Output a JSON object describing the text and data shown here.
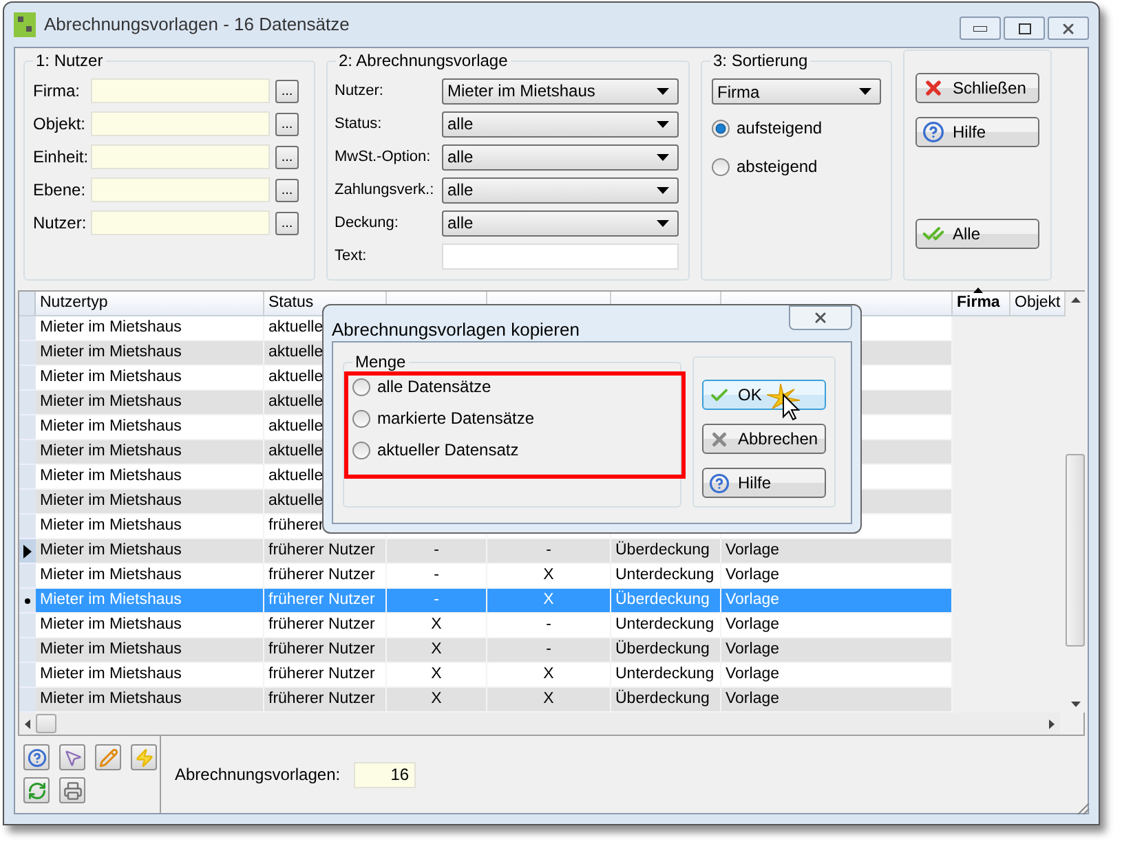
{
  "window": {
    "title": "Abrechnungsvorlagen - 16 Datensätze"
  },
  "nutzer_group": {
    "title": "1: Nutzer",
    "fields": [
      {
        "label": "Firma:",
        "button": "..."
      },
      {
        "label": "Objekt:",
        "button": "..."
      },
      {
        "label": "Einheit:",
        "button": "..."
      },
      {
        "label": "Ebene:",
        "button": "..."
      },
      {
        "label": "Nutzer:",
        "button": "..."
      }
    ]
  },
  "vorlage_group": {
    "title": "2: Abrechnungsvorlage",
    "fields": [
      {
        "label": "Nutzer:",
        "kind": "dropdown",
        "value": "Mieter im Mietshaus"
      },
      {
        "label": "Status:",
        "kind": "dropdown",
        "value": "alle"
      },
      {
        "label": "MwSt.-Option:",
        "kind": "dropdown",
        "value": "alle"
      },
      {
        "label": "Zahlungsverk.:",
        "kind": "dropdown",
        "value": "alle"
      },
      {
        "label": "Deckung:",
        "kind": "dropdown",
        "value": "alle"
      },
      {
        "label": "Text:",
        "kind": "text"
      }
    ]
  },
  "sort_group": {
    "title": "3: Sortierung",
    "value": "Firma",
    "options": [
      {
        "label": "aufsteigend",
        "selected": true
      },
      {
        "label": "absteigend",
        "selected": false
      }
    ]
  },
  "actions": [
    {
      "label": "Schließen",
      "kind": "close"
    },
    {
      "label": "Hilfe",
      "kind": "help"
    },
    {
      "label": "Alle",
      "kind": "all"
    }
  ],
  "table": {
    "columns": [
      {
        "label": "Nutzertyp"
      },
      {
        "label": "Status"
      },
      {},
      {},
      {},
      {},
      {
        "label": "Firma",
        "sorted": true
      },
      {
        "label": "Objekt"
      }
    ],
    "rows": [
      {
        "cells": [
          "Mieter im Mietshaus",
          "aktuelle"
        ],
        "current": false,
        "selected": false
      },
      {
        "cells": [
          "Mieter im Mietshaus",
          "aktuelle"
        ],
        "current": false,
        "selected": false
      },
      {
        "cells": [
          "Mieter im Mietshaus",
          "aktuelle"
        ],
        "current": false,
        "selected": false
      },
      {
        "cells": [
          "Mieter im Mietshaus",
          "aktuelle"
        ],
        "current": false,
        "selected": false
      },
      {
        "cells": [
          "Mieter im Mietshaus",
          "aktuelle"
        ],
        "current": false,
        "selected": false
      },
      {
        "cells": [
          "Mieter im Mietshaus",
          "aktuelle"
        ],
        "current": false,
        "selected": false
      },
      {
        "cells": [
          "Mieter im Mietshaus",
          "aktuelle"
        ],
        "current": false,
        "selected": false
      },
      {
        "cells": [
          "Mieter im Mietshaus",
          "aktuelle"
        ],
        "current": false,
        "selected": false
      },
      {
        "cells": [
          "Mieter im Mietshaus",
          "früherer"
        ],
        "current": false,
        "selected": false
      },
      {
        "cells": [
          "Mieter im Mietshaus",
          "früherer Nutzer",
          "-",
          "-",
          "Überdeckung",
          "Vorlage"
        ],
        "current": true,
        "selected": false
      },
      {
        "cells": [
          "Mieter im Mietshaus",
          "früherer Nutzer",
          "-",
          "X",
          "Unterdeckung",
          "Vorlage"
        ],
        "current": false,
        "selected": false
      },
      {
        "cells": [
          "Mieter im Mietshaus",
          "früherer Nutzer",
          "-",
          "X",
          "Überdeckung",
          "Vorlage"
        ],
        "current": false,
        "selected": true
      },
      {
        "cells": [
          "Mieter im Mietshaus",
          "früherer Nutzer",
          "X",
          "-",
          "Unterdeckung",
          "Vorlage"
        ],
        "current": false,
        "selected": false
      },
      {
        "cells": [
          "Mieter im Mietshaus",
          "früherer Nutzer",
          "X",
          "-",
          "Überdeckung",
          "Vorlage"
        ],
        "current": false,
        "selected": false
      },
      {
        "cells": [
          "Mieter im Mietshaus",
          "früherer Nutzer",
          "X",
          "X",
          "Unterdeckung",
          "Vorlage"
        ],
        "current": false,
        "selected": false
      },
      {
        "cells": [
          "Mieter im Mietshaus",
          "früherer Nutzer",
          "X",
          "X",
          "Überdeckung",
          "Vorlage"
        ],
        "current": false,
        "selected": false
      }
    ]
  },
  "footer": {
    "tools": [
      {
        "kind": "help"
      },
      {
        "kind": "pointer"
      },
      {
        "kind": "pencil"
      },
      {
        "kind": "lightning"
      },
      {
        "kind": "refresh"
      },
      {
        "kind": "print"
      }
    ],
    "count_label": "Abrechnungsvorlagen:",
    "count": "16"
  },
  "dialog": {
    "title": "Abrechnungsvorlagen kopieren",
    "group": {
      "title": "Menge",
      "highlighted": true,
      "options": [
        {
          "label": "alle Datensätze",
          "selected": false
        },
        {
          "label": "markierte Datensätze",
          "selected": false
        },
        {
          "label": "aktueller Datensatz",
          "selected": false
        }
      ]
    },
    "buttons": [
      {
        "label": "OK",
        "kind": "ok",
        "focused": true
      },
      {
        "label": "Abbrechen",
        "kind": "cancel",
        "focused": false
      },
      {
        "label": "Hilfe",
        "kind": "help",
        "focused": false
      }
    ]
  }
}
